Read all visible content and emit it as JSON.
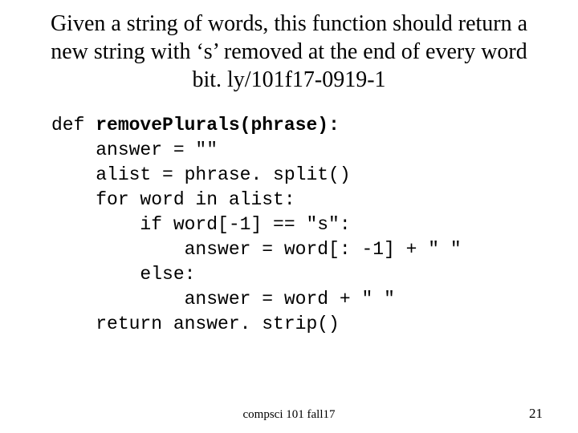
{
  "title": {
    "line1": "Given a string of words, this function should return a",
    "line2": "new string with ‘s’ removed at the end of every word",
    "line3": "bit. ly/101f17-0919-1"
  },
  "code": {
    "l1_a": "def ",
    "l1_b": "removePlurals(phrase):",
    "l2": "    answer = \"\"",
    "l3": "    alist = phrase. split()",
    "l4": "    for word in alist:",
    "l5": "        if word[-1] == \"s\":",
    "l6": "            answer = word[: -1] + \" \"",
    "l7": "        else:",
    "l8": "            answer = word + \" \"",
    "l9": "    return answer. strip()"
  },
  "footer": {
    "center": "compsci 101 fall17",
    "page": "21"
  }
}
